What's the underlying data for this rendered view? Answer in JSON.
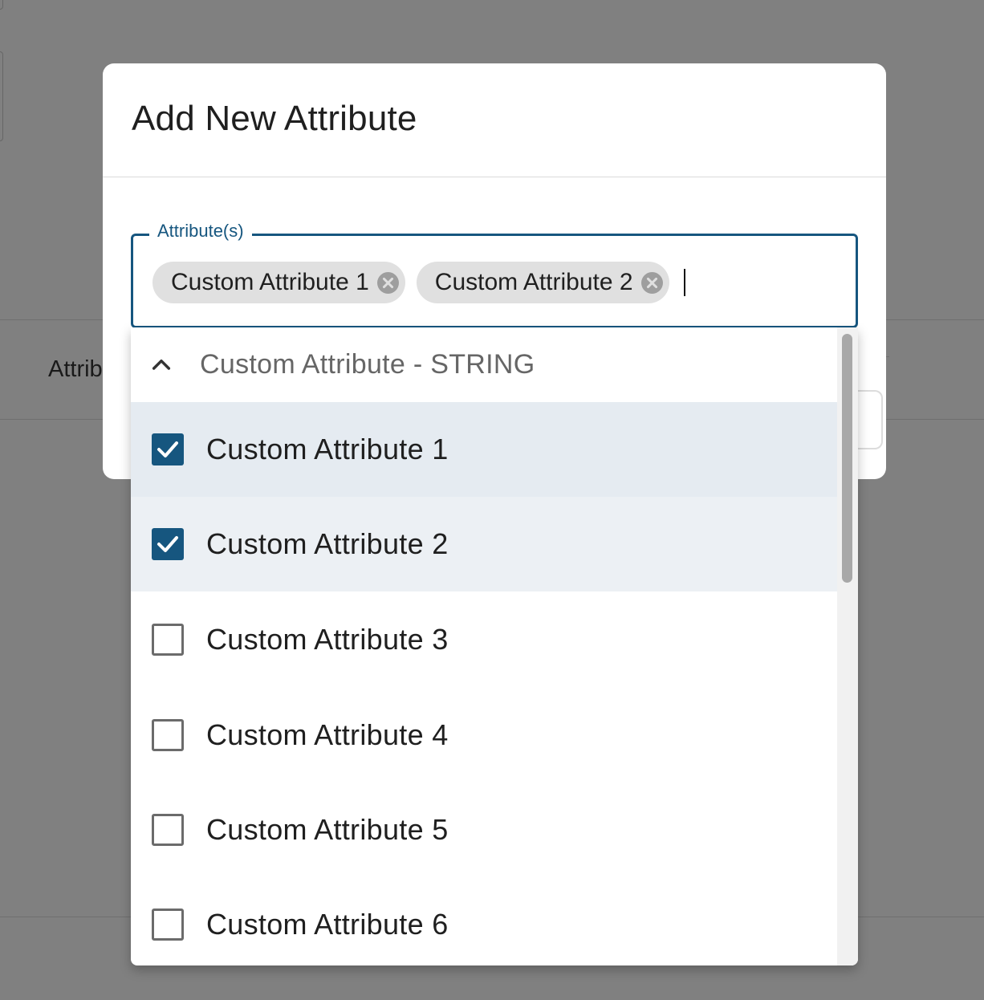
{
  "background": {
    "partial_label": "Attrib"
  },
  "modal": {
    "title": "Add New Attribute"
  },
  "field": {
    "label": "Attribute(s)",
    "chips": [
      {
        "label": "Custom Attribute 1"
      },
      {
        "label": "Custom Attribute 2"
      }
    ]
  },
  "dropdown": {
    "group_label": "Custom Attribute - STRING",
    "options": [
      {
        "label": "Custom Attribute 1",
        "checked": true
      },
      {
        "label": "Custom Attribute 2",
        "checked": true
      },
      {
        "label": "Custom Attribute 3",
        "checked": false
      },
      {
        "label": "Custom Attribute 4",
        "checked": false
      },
      {
        "label": "Custom Attribute 5",
        "checked": false
      },
      {
        "label": "Custom Attribute 6",
        "checked": false
      }
    ]
  },
  "colors": {
    "accent": "#16567f",
    "chip_bg": "#e0e0e0",
    "selected_row": "#e5ebf1",
    "overlay": "#808080"
  },
  "icons": {
    "chip_remove": "close-circle-icon",
    "group_toggle": "chevron-up-icon",
    "checked": "checkbox-checked-icon",
    "unchecked": "checkbox-unchecked-icon"
  }
}
